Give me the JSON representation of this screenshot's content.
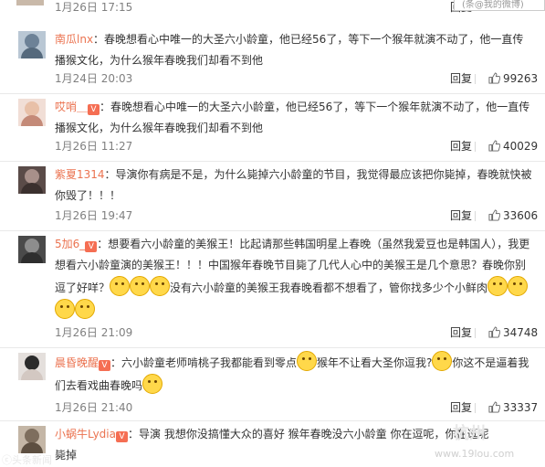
{
  "top": {
    "time": "1月26日 17:15",
    "corner_text": "(条@我的微博)"
  },
  "comments": [
    {
      "user": "南瓜lnx",
      "text": "：春晚想看心中唯一的大圣六小龄童，他已经56了，等下一个猴年就演不动了，他一直传播猴文化，为什么猴年春晚我们却看不到他",
      "time": "1月24日 20:03",
      "reply": "回复",
      "likes": "99263"
    },
    {
      "user": "哎哨＿",
      "text": "：春晚想看心中唯一的大圣六小龄童，他已经56了，等下一个猴年就演不动了，他一直传播猴文化，为什么猴年春晚我们却看不到他",
      "time": "1月26日 11:27",
      "reply": "回复",
      "likes": "40029"
    },
    {
      "user": "紫夏1314",
      "text": "：导演你有病是不是，为什么毙掉六小龄童的节目，我觉得最应该把你毙掉，春晚就快被你毁了！！！",
      "time": "1月26日 19:47",
      "reply": "回复",
      "likes": "33606"
    },
    {
      "user": "5加6_",
      "text_a": "：想要看六小龄童的美猴王！比起请那些韩国明星上春晚（虽然我爱豆也是韩国人），我更想看六小龄童演的美猴王！！！中国猴年春晚节目毙了几代人心中的美猴王是几个意思？春晚你别逗了好咩？",
      "text_b": "没有六小龄童的美猴王我春晚看都不想看了，管你找多少个小鲜肉",
      "time": "1月26日 21:09",
      "reply": "回复",
      "likes": "34748"
    },
    {
      "user": "晨昏晚醒",
      "text_a": "：六小龄童老师啃桃子我都能看到零点",
      "text_b": "猴年不让看大圣你逗我?",
      "text_c": "你这不是逼着我们去看戏曲春晚吗",
      "time": "1月26日 21:40",
      "reply": "回复",
      "likes": "33337"
    },
    {
      "user": "小蜗牛Lydia",
      "text": "：导演 我想你没搞懂大众的喜好 猴年春晚没六小龄童 你在逗呢，你在逗呢",
      "text2": "毙掉"
    }
  ],
  "watermark": {
    "left": "ⓒ头条新闻",
    "right": "www.19lou.com",
    "logo": "杭州"
  },
  "colors": {
    "username": "#eb7350",
    "vip": "#f56e53",
    "time": "#808080"
  }
}
